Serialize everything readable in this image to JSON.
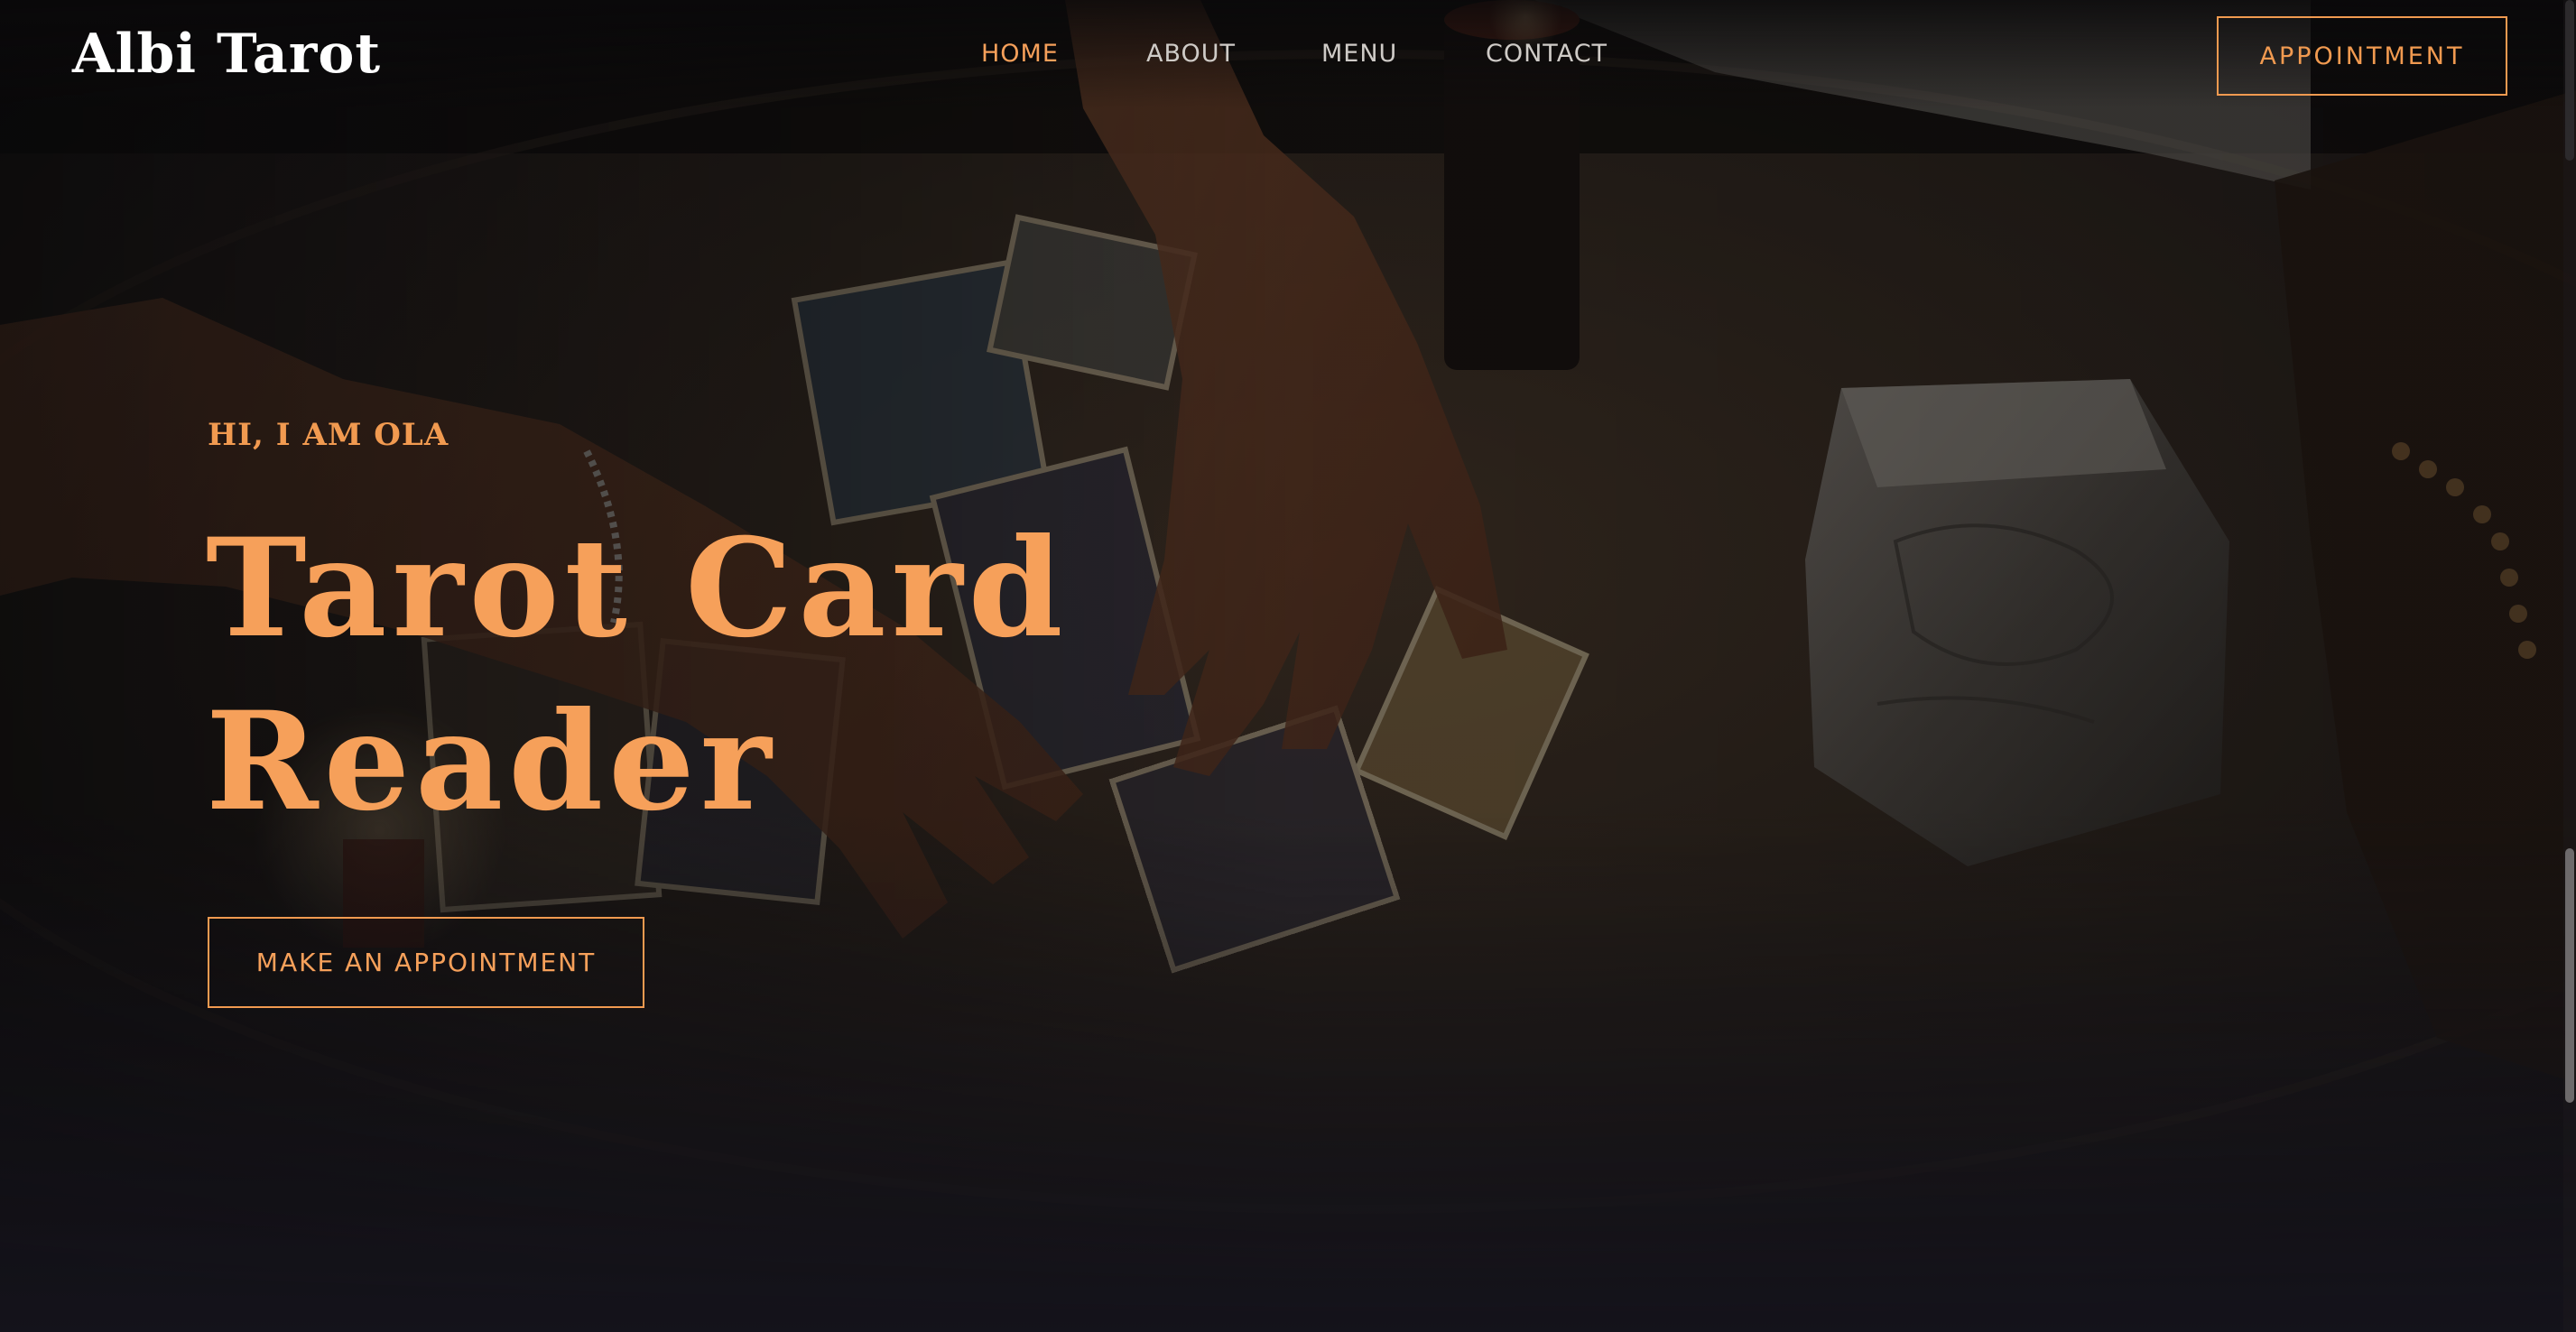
{
  "brand": {
    "name": "Albi Tarot"
  },
  "nav": {
    "items": [
      {
        "label": "HOME",
        "active": true
      },
      {
        "label": "ABOUT",
        "active": false
      },
      {
        "label": "MENU",
        "active": false
      },
      {
        "label": "CONTACT",
        "active": false
      }
    ],
    "appointment_label": "APPOINTMENT"
  },
  "hero": {
    "eyebrow": "HI, I AM OLA",
    "title_line1": "Tarot Card",
    "title_line2": "Reader",
    "cta_label": "MAKE AN APPOINTMENT"
  },
  "colors": {
    "accent": "#f19a50",
    "accent_light": "#f6a05a",
    "background": "#1c1a1f",
    "nav_text": "#cfcbc7",
    "logo_text": "#ffffff"
  },
  "icons": {
    "background_image": "tarot-reading-photo"
  }
}
